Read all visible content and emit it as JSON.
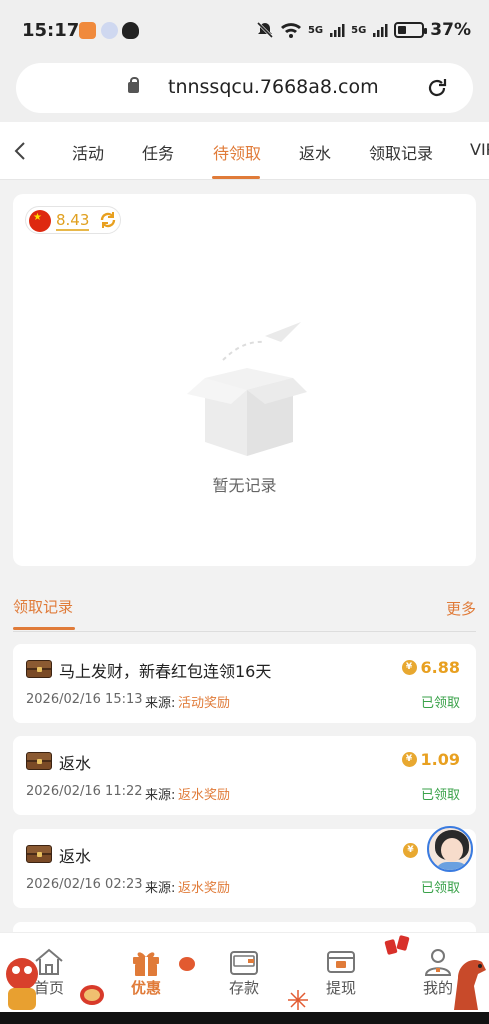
{
  "status_bar": {
    "time": "15:17",
    "signal_1": "5G",
    "signal_2": "5G",
    "battery": "37%",
    "battery_level": 0.37
  },
  "browser": {
    "url": "tnnssqcu.7668a8.com"
  },
  "tabs": [
    {
      "label": "活动"
    },
    {
      "label": "任务"
    },
    {
      "label": "待领取"
    },
    {
      "label": "返水"
    },
    {
      "label": "领取记录"
    },
    {
      "label": "VIP"
    }
  ],
  "active_tab": "待领取",
  "balance": {
    "value": "8.43"
  },
  "empty_state": {
    "text": "暂无记录"
  },
  "records_section": {
    "title": "领取记录",
    "more": "更多",
    "source_label": "来源:",
    "items": [
      {
        "name": "马上发财，新春红包连领16天",
        "amount": "6.88",
        "date": "2026/02/16 15:13",
        "source": "活动奖励",
        "status": "已领取"
      },
      {
        "name": "返水",
        "amount": "1.09",
        "date": "2026/02/16 11:22",
        "source": "返水奖励",
        "status": "已领取"
      },
      {
        "name": "返水",
        "amount": "",
        "date": "2026/02/16 02:23",
        "source": "返水奖励",
        "status": "已领取"
      }
    ]
  },
  "bottom_nav": [
    {
      "label": "首页",
      "icon": "home-icon"
    },
    {
      "label": "优惠",
      "icon": "gift-icon"
    },
    {
      "label": "存款",
      "icon": "wallet-icon"
    },
    {
      "label": "提现",
      "icon": "withdraw-icon"
    },
    {
      "label": "我的",
      "icon": "profile-icon"
    }
  ],
  "active_nav": "优惠",
  "colors": {
    "accent": "#e07b39",
    "gold": "#e8a020",
    "success": "#3aa24a"
  }
}
